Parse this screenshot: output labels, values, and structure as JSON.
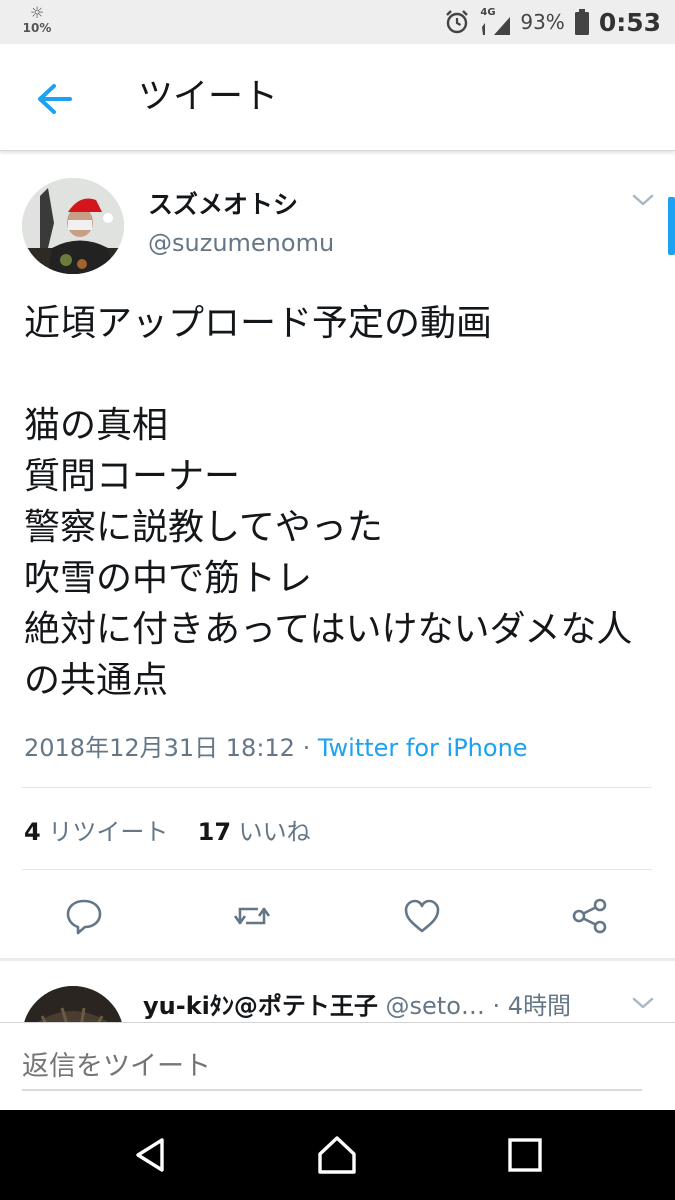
{
  "status_bar": {
    "brightness_icon": "sun-icon",
    "brightness": "10%",
    "network": "4G",
    "battery": "93%",
    "time": "0:53"
  },
  "header": {
    "back_icon": "arrow-left-icon",
    "title": "ツイート"
  },
  "tweet": {
    "display_name": "スズメオトシ",
    "handle": "@suzumenomu",
    "text": "近頃アップロード予定の動画\n\n猫の真相\n質問コーナー\n警察に説教してやった\n吹雪の中で筋トレ\n絶対に付きあってはいけないダメな人の共通点",
    "timestamp": "2018年12月31日 18:12",
    "separator": " · ",
    "source": "Twitter for iPhone",
    "retweet_count": "4",
    "retweet_label": "リツイート",
    "like_count": "17",
    "like_label": "いいね"
  },
  "actions": [
    "reply-icon",
    "retweet-icon",
    "like-icon",
    "share-icon"
  ],
  "reply": {
    "name": "yu-kiﾀﾝ@ポテト王子",
    "handle": "@seto…",
    "time": " · 4時間"
  },
  "compose": {
    "placeholder": "返信をツイート"
  },
  "colors": {
    "accent": "#1da1f2",
    "secondary_text": "#657786",
    "primary_text": "#14171a"
  }
}
